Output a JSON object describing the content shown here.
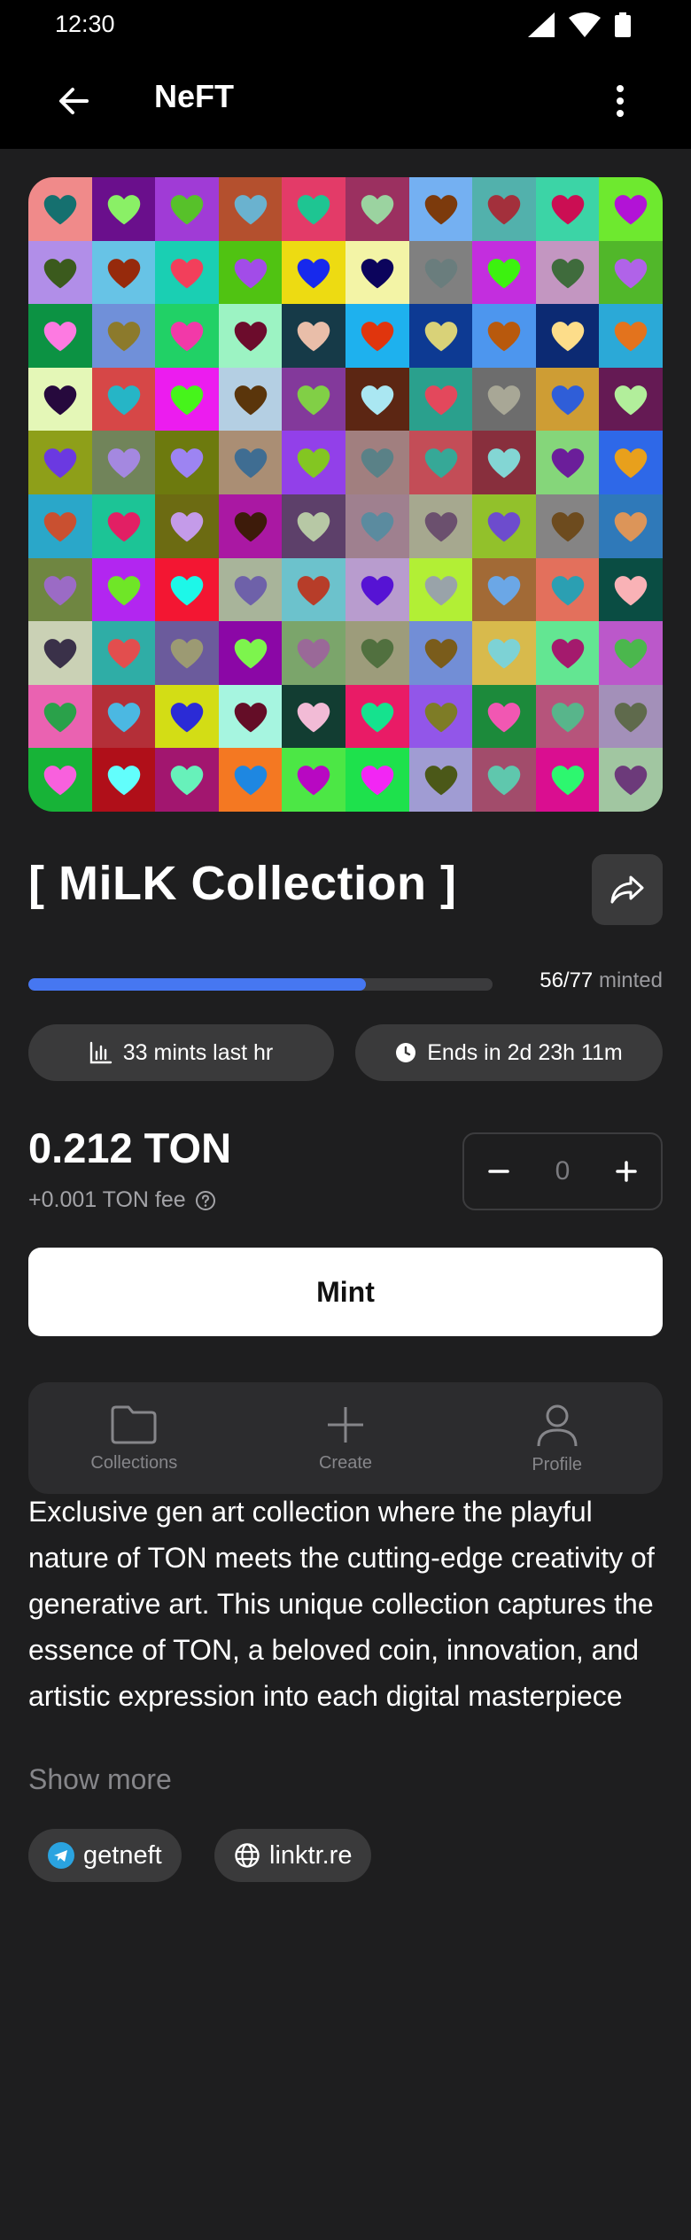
{
  "status_bar": {
    "time": "12:30"
  },
  "app_bar": {
    "title": "NeFT"
  },
  "collection": {
    "title": "[ MiLK Collection ]"
  },
  "mint_progress": {
    "minted": 56,
    "total": 77,
    "count_text": "56/77",
    "suffix": "minted",
    "fraction": 0.727
  },
  "stats": {
    "mints_last_hr": "33 mints last hr",
    "ends_in": "Ends in 2d 23h 11m"
  },
  "price": {
    "amount": "0.212 TON",
    "fee": "+0.001 TON fee"
  },
  "quantity": {
    "value": "0"
  },
  "mint_button": {
    "label": "Mint"
  },
  "tabs": [
    {
      "label": "Collections",
      "icon": "folder-icon"
    },
    {
      "label": "Create",
      "icon": "plus-icon"
    },
    {
      "label": "Profile",
      "icon": "person-icon"
    }
  ],
  "description": {
    "text": "Exclusive gen art collection where the playful nature of TON meets the cutting-edge creativity of generative art. This unique collection captures the essence of TON, a beloved coin, innovation, and artistic expression into each digital masterpiece",
    "show_more": "Show more"
  },
  "links": [
    {
      "label": "getneft",
      "icon": "telegram-icon"
    },
    {
      "label": "linktr.re",
      "icon": "globe-icon"
    }
  ],
  "artwork": {
    "cols": 10,
    "rows": 10,
    "cells": [
      [
        "#f08a8a",
        "#15706f"
      ],
      [
        "#6a0f8c",
        "#8af066"
      ],
      [
        "#a03bd6",
        "#57c12a"
      ],
      [
        "#b4502e",
        "#6ab2cf"
      ],
      [
        "#e33b68",
        "#1ec592"
      ],
      [
        "#9b3060",
        "#9bd3a0"
      ],
      [
        "#74b0f2",
        "#7c3a0c"
      ],
      [
        "#52b1ac",
        "#a3303c"
      ],
      [
        "#3cd4a6",
        "#cb0e53"
      ],
      [
        "#6ee92f",
        "#b213d6"
      ],
      [
        "#b18ee8",
        "#3b5a1d"
      ],
      [
        "#67c3e6",
        "#962a0c"
      ],
      [
        "#1acfb3",
        "#f23f5b"
      ],
      [
        "#50c312",
        "#a24ce8"
      ],
      [
        "#eddb12",
        "#1729ed"
      ],
      [
        "#f3f4a6",
        "#0c045c"
      ],
      [
        "#808080",
        "#6a7d7d"
      ],
      [
        "#c32ede",
        "#3cf20f"
      ],
      [
        "#c396c1",
        "#3f6b3c"
      ],
      [
        "#51b72a",
        "#b063e8"
      ],
      [
        "#0c9243",
        "#fd7ae1"
      ],
      [
        "#7090d9",
        "#8c7a2c"
      ],
      [
        "#21d166",
        "#f239a8"
      ],
      [
        "#9cf3c3",
        "#6c0c2c"
      ],
      [
        "#163a48",
        "#e9bea9"
      ],
      [
        "#1eb1ee",
        "#e0350d"
      ],
      [
        "#0d3a93",
        "#d9d278"
      ],
      [
        "#4d96ee",
        "#b8590d"
      ],
      [
        "#0c2a73",
        "#fddd8a"
      ],
      [
        "#2ba9d7",
        "#e3731d"
      ],
      [
        "#e4f7b7",
        "#26093d"
      ],
      [
        "#d64747",
        "#26b5c6"
      ],
      [
        "#ec1cef",
        "#46f41b"
      ],
      [
        "#b4cfe3",
        "#5a350b"
      ],
      [
        "#83399b",
        "#81cf46"
      ],
      [
        "#5c2613",
        "#aae7f2"
      ],
      [
        "#2aa08d",
        "#e3485c"
      ],
      [
        "#6d6d6d",
        "#a8a796"
      ],
      [
        "#ce9d34",
        "#2f5ed8"
      ],
      [
        "#651a54",
        "#b2ee9b"
      ],
      [
        "#8e9f19",
        "#6b39e1"
      ],
      [
        "#71845a",
        "#a488e0"
      ],
      [
        "#6d7a0e",
        "#9d84f2"
      ],
      [
        "#aa8e74",
        "#3f6d92"
      ],
      [
        "#9240e9",
        "#83c622"
      ],
      [
        "#a17f7f",
        "#5a8187"
      ],
      [
        "#c34d57",
        "#36a897"
      ],
      [
        "#882f3d",
        "#83d6d4"
      ],
      [
        "#85d67a",
        "#6b1e9a"
      ],
      [
        "#2e68e8",
        "#e8a01c"
      ],
      [
        "#2aa7c9",
        "#c95030"
      ],
      [
        "#1cc496",
        "#e21f64"
      ],
      [
        "#6c6b12",
        "#c49be9"
      ],
      [
        "#aa18a3",
        "#3d1b0a"
      ],
      [
        "#5d406a",
        "#b7c8a5"
      ],
      [
        "#9f808f",
        "#5b8b9f"
      ],
      [
        "#a6a88f",
        "#6b506e"
      ],
      [
        "#92c12b",
        "#6d4ccd"
      ],
      [
        "#858484",
        "#6d4b1e"
      ],
      [
        "#2f79b9",
        "#dc9559"
      ],
      [
        "#6f8641",
        "#9b6bc5"
      ],
      [
        "#b226f0",
        "#6fe627"
      ],
      [
        "#f31632",
        "#1df7e8"
      ],
      [
        "#a8b49a",
        "#6e61a9"
      ],
      [
        "#6cc2cc",
        "#b73d29"
      ],
      [
        "#b89cce",
        "#5613d4"
      ],
      [
        "#b2ef35",
        "#99a3a9"
      ],
      [
        "#a26a36",
        "#6ba7e6"
      ],
      [
        "#e3705c",
        "#2b9fb2"
      ],
      [
        "#0a4d43",
        "#f9b2b6"
      ],
      [
        "#cad1b5",
        "#3a3149"
      ],
      [
        "#2fada6",
        "#e24e4e"
      ],
      [
        "#6b5b9c",
        "#9c9a73"
      ],
      [
        "#8b07a6",
        "#7df44d"
      ],
      [
        "#7ba56b",
        "#9a6998"
      ],
      [
        "#9d9c7b",
        "#51703f"
      ],
      [
        "#728ed6",
        "#7a5c1b"
      ],
      [
        "#d8ba4c",
        "#7dd2d5"
      ],
      [
        "#63e692",
        "#a41a6d"
      ],
      [
        "#bb58ca",
        "#4bb74d"
      ],
      [
        "#ea62b1",
        "#2aa14a"
      ],
      [
        "#b42f38",
        "#4bb8e2"
      ],
      [
        "#d3dd15",
        "#2b2bd6"
      ],
      [
        "#a6f5e0",
        "#640d27"
      ],
      [
        "#123d32",
        "#f2bbd6"
      ],
      [
        "#e91b66",
        "#15e28e"
      ],
      [
        "#9256e9",
        "#7e7c26"
      ],
      [
        "#1c8a3b",
        "#f157b2"
      ],
      [
        "#b6547b",
        "#58b58b"
      ],
      [
        "#a390b9",
        "#5f6a4c"
      ],
      [
        "#17b337",
        "#f860dd"
      ],
      [
        "#b00f19",
        "#62fefc"
      ],
      [
        "#a2166f",
        "#67f1ba"
      ],
      [
        "#f47822",
        "#1e87e1"
      ],
      [
        "#4ce745",
        "#b808c2"
      ],
      [
        "#1ee14c",
        "#f226f4"
      ],
      [
        "#a09cd3",
        "#4b5818"
      ],
      [
        "#a24c6b",
        "#5fc7ad"
      ],
      [
        "#da0e90",
        "#2df76f"
      ],
      [
        "#a1c6a1",
        "#6c3a7a"
      ]
    ]
  }
}
